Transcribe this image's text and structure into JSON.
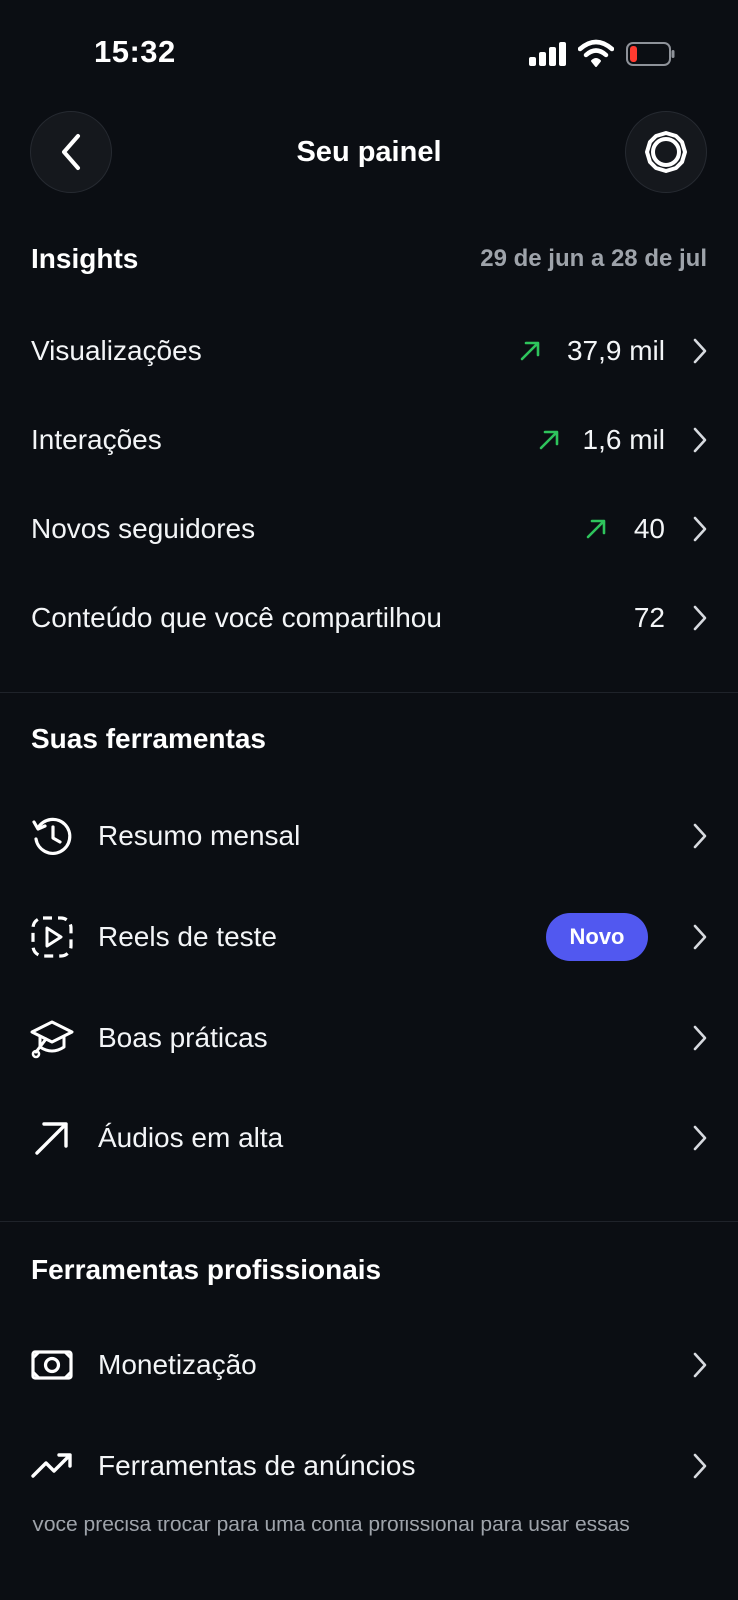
{
  "status_bar": {
    "time": "15:32",
    "signal_icon": "cellular-signal-icon",
    "wifi_icon": "wifi-icon",
    "battery_icon": "battery-low-icon",
    "battery_color": "#ff3b30"
  },
  "header": {
    "title": "Seu painel",
    "back_icon": "chevron-left-icon",
    "settings_icon": "gear-icon"
  },
  "insights": {
    "title": "Insights",
    "date_range": "29 de jun a 28 de jul",
    "trend_color": "#2ec45c",
    "rows": [
      {
        "label": "Visualizações",
        "value": "37,9 mil",
        "trend": "up"
      },
      {
        "label": "Interações",
        "value": "1,6 mil",
        "trend": "up"
      },
      {
        "label": "Novos seguidores",
        "value": "40",
        "trend": "up"
      },
      {
        "label": "Conteúdo que você compartilhou",
        "value": "72",
        "trend": "none"
      }
    ]
  },
  "tools": {
    "title": "Suas ferramentas",
    "items": [
      {
        "label": "Resumo mensal",
        "icon": "history-clock-icon"
      },
      {
        "label": "Reels de teste",
        "icon": "reels-test-icon",
        "badge": "Novo"
      },
      {
        "label": "Boas práticas",
        "icon": "graduation-cap-icon"
      },
      {
        "label": "Áudios em alta",
        "icon": "arrow-up-right-icon"
      }
    ]
  },
  "pro_tools": {
    "title": "Ferramentas profissionais",
    "items": [
      {
        "label": "Monetização",
        "icon": "money-icon"
      },
      {
        "label": "Ferramentas de anúncios",
        "icon": "trending-up-icon"
      }
    ],
    "note": "Você precisa trocar para uma conta profissional para usar essas"
  },
  "colors": {
    "background": "#0b0e13",
    "badge": "#5158f0",
    "secondary_text": "#9ea3aa"
  }
}
